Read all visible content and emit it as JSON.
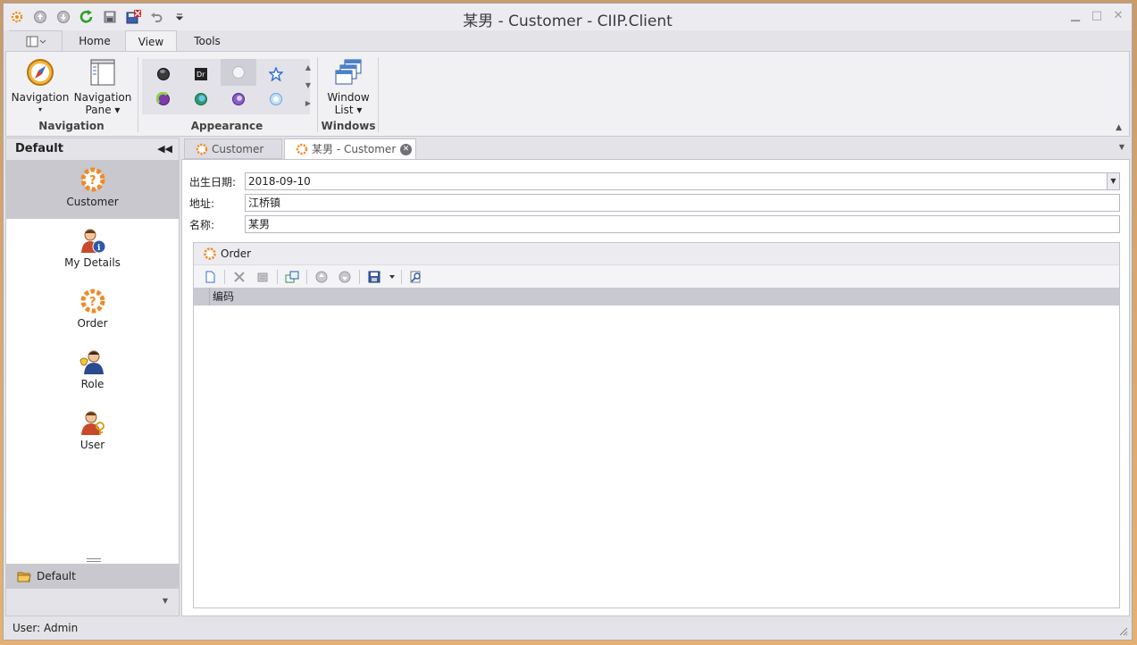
{
  "window": {
    "title": "某男 - Customer - CIIP.Client"
  },
  "ribbon": {
    "tabs": [
      "Home",
      "View",
      "Tools"
    ],
    "active_tab": "View",
    "groups": {
      "navigation": {
        "label": "Navigation",
        "buttons": [
          {
            "line1": "Navigation",
            "line2": "▾"
          },
          {
            "line1": "Navigation",
            "line2": "Pane ▾"
          }
        ]
      },
      "appearance": {
        "label": "Appearance"
      },
      "windows": {
        "label": "Windows",
        "buttons": [
          {
            "line1": "Window",
            "line2": "List ▾"
          }
        ]
      }
    }
  },
  "nav": {
    "header": "Default",
    "items": [
      {
        "label": "Customer",
        "icon": "customer-icon"
      },
      {
        "label": "My Details",
        "icon": "my-details-icon"
      },
      {
        "label": "Order",
        "icon": "order-icon"
      },
      {
        "label": "Role",
        "icon": "role-icon"
      },
      {
        "label": "User",
        "icon": "user-icon"
      }
    ],
    "active_item": "Customer",
    "group": "Default"
  },
  "doc_tabs": [
    {
      "label": "Customer"
    },
    {
      "label": "某男 - Customer"
    }
  ],
  "form": {
    "birth_label": "出生日期:",
    "birth_value": "2018-09-10",
    "address_label": "地址:",
    "address_value": "江桥镇",
    "name_label": "名称:",
    "name_value": "某男"
  },
  "order": {
    "title": "Order",
    "columns": [
      "编码"
    ]
  },
  "status": {
    "user": "User: Admin"
  },
  "colors": {
    "accent_orange": "#f08a24",
    "nav_active_bg": "#c8c8ce"
  }
}
